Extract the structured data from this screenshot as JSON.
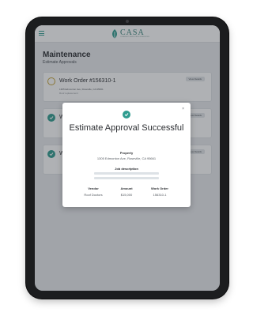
{
  "app": {
    "brand": "CASA",
    "brand_tagline": "COMMUNITY ASSOCIATION SERVICES",
    "accent_color": "#2f9c8f"
  },
  "header": {
    "menu_icon": "hamburger-icon",
    "title": "Maintenance",
    "subtitle": "Estimate Approvals"
  },
  "work_orders": [
    {
      "title": "Work Order #156310-1",
      "address": "1305 Edmonton Ave, Roseville, CA 95661",
      "subtitle": "Roof replacement",
      "status": "pending",
      "action_label": "View Details"
    },
    {
      "title": "W",
      "address": "",
      "subtitle": "",
      "status": "approved",
      "action_label": "View Details"
    },
    {
      "title": "W",
      "address": "",
      "subtitle": "",
      "status": "approved",
      "action_label": "View Details"
    }
  ],
  "modal": {
    "close_label": "×",
    "title": "Estimate Approval Successful",
    "property_label": "Property",
    "property_value": "1305 Edmonton Ave, Roseville, CA 95661",
    "job_description_label": "Job description",
    "vendor_label": "Vendor",
    "vendor_value": "Roof Doctors",
    "amount_label": "Amount",
    "amount_value": "$15,000",
    "work_order_label": "Work Order",
    "work_order_value": "156310-1"
  }
}
